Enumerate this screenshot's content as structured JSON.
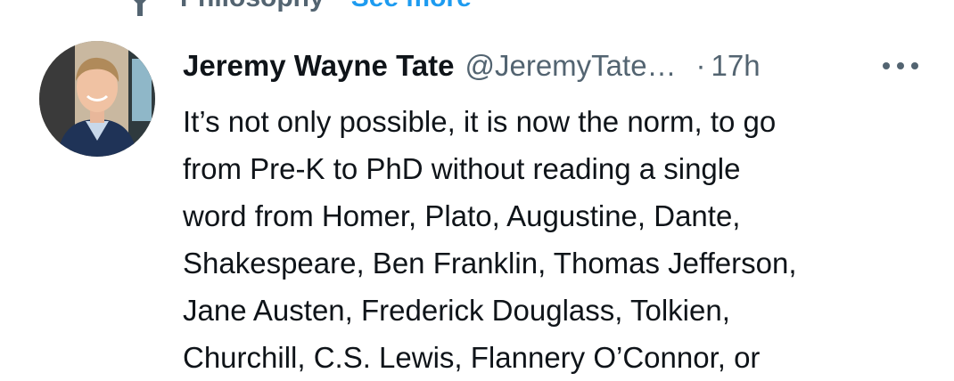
{
  "context": {
    "topic": "Philosophy",
    "see_more": "See more"
  },
  "tweet": {
    "author_name": "Jeremy Wayne Tate",
    "handle": "@JeremyTate…",
    "separator": "·",
    "time": "17h",
    "lines": [
      "It’s not only possible, it is now the norm, to go",
      "from Pre-K to PhD without reading a single",
      "word from Homer, Plato, Augustine, Dante,",
      "Shakespeare, Ben Franklin, Thomas Jefferson,",
      "Jane Austen, Frederick Douglass, Tolkien,",
      "Churchill, C.S. Lewis, Flannery O’Connor, or"
    ]
  },
  "icons": {
    "topic": "topic-pin-icon",
    "more": "more-options-icon",
    "avatar": "avatar"
  },
  "colors": {
    "text_primary": "#0f1419",
    "text_secondary": "#536471",
    "link": "#1d9bf0"
  }
}
